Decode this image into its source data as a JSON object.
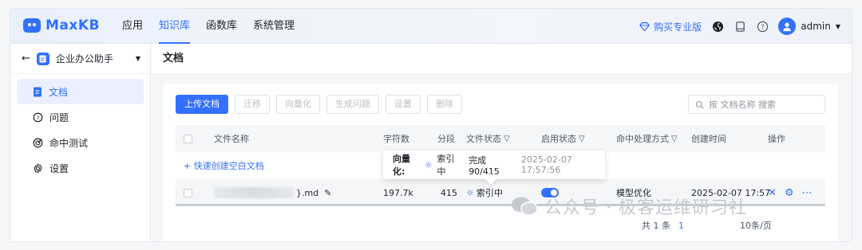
{
  "app": {
    "brand": "MaxKB"
  },
  "nav": {
    "items": [
      "应用",
      "知识库",
      "函数库",
      "系统管理"
    ],
    "active_index": 1
  },
  "header_right": {
    "buy_label": "购买专业版",
    "user_name": "admin"
  },
  "sidebar": {
    "kb_name": "企业办公助手",
    "items": [
      {
        "label": "文档",
        "icon": "document-icon",
        "active": true
      },
      {
        "label": "问题",
        "icon": "question-icon",
        "active": false
      },
      {
        "label": "命中测试",
        "icon": "target-icon",
        "active": false
      },
      {
        "label": "设置",
        "icon": "gear-icon",
        "active": false
      }
    ]
  },
  "main": {
    "title": "文档",
    "toolbar": {
      "upload": "上传文档",
      "migrate": "迁移",
      "vectorize": "向量化",
      "generate": "生成问题",
      "settings": "设置",
      "delete": "删除"
    },
    "search": {
      "placeholder": "按 文档名称 搜索"
    },
    "table": {
      "columns": [
        "文件名称",
        "字符数",
        "分段",
        "文件状态",
        "启用状态",
        "命中处理方式",
        "创建时间",
        "操作"
      ],
      "quick_create": "+ 快速创建空白文档",
      "rows": [
        {
          "name_suffix": "}.md",
          "chars": "197.7k",
          "segments": "415",
          "status": "索引中",
          "enabled": true,
          "hit_mode": "模型优化",
          "created": "2025-02-07 17:57"
        }
      ]
    },
    "tooltip": {
      "label": "向量化:",
      "status": "索引中",
      "progress": "完成 90/415",
      "time": "2025-02-07 17:57:56"
    },
    "footer": {
      "total": "共 1 条",
      "page": "1",
      "per_page": "10条/页"
    }
  },
  "watermark": {
    "text": "公众号 · 极客运维研习社"
  },
  "colors": {
    "accent": "#3370ff",
    "sidebar_active_bg": "#eaf0ff"
  }
}
